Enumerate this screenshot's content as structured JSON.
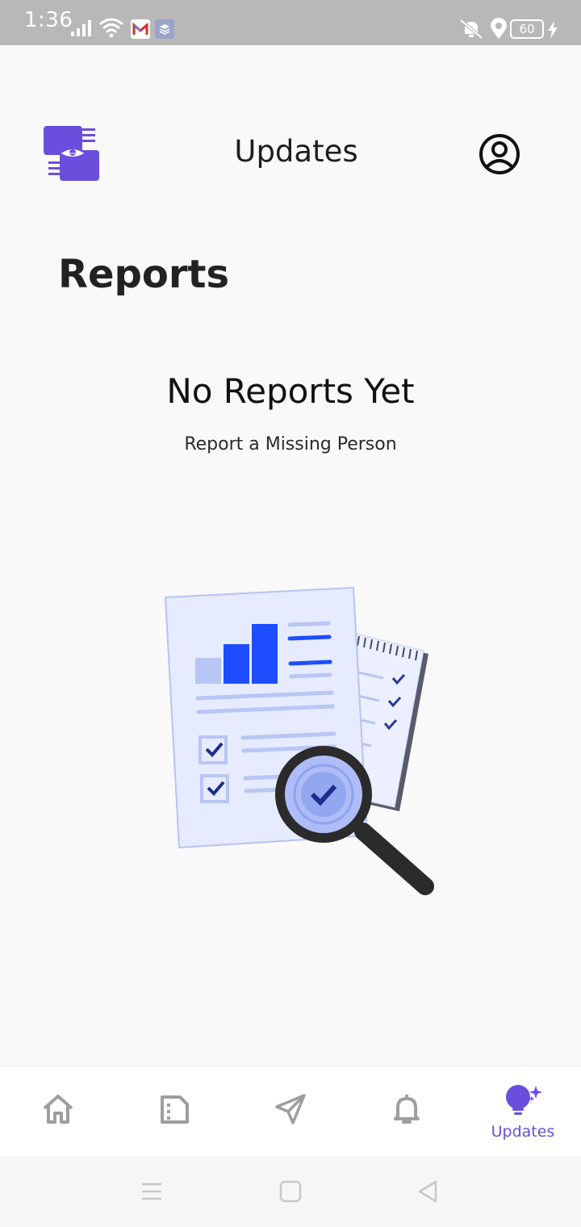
{
  "status_bar": {
    "time": "1:36",
    "battery": "60",
    "icons": [
      "signal-icon",
      "wifi-icon",
      "gmail-icon",
      "layers-app-icon",
      "vibrate-off-icon",
      "location-icon",
      "battery-icon",
      "charging-icon"
    ]
  },
  "header": {
    "title": "Updates",
    "logo_icon": "hands-eye-logo-icon",
    "profile_icon": "account-circle-icon"
  },
  "main": {
    "section_title": "Reports",
    "empty_state": {
      "title": "No Reports Yet",
      "subtitle": "Report a Missing Person",
      "illustration": "report-analysis-illustration"
    }
  },
  "bottom_nav": {
    "items": [
      {
        "icon": "home-icon",
        "label": "",
        "active": false
      },
      {
        "icon": "document-icon",
        "label": "",
        "active": false
      },
      {
        "icon": "send-icon",
        "label": "",
        "active": false
      },
      {
        "icon": "bell-icon",
        "label": "",
        "active": false
      },
      {
        "icon": "lightbulb-sparkle-icon",
        "label": "Updates",
        "active": true
      }
    ]
  },
  "system_nav": [
    "recents-icon",
    "home-square-icon",
    "back-icon"
  ],
  "colors": {
    "accent": "#6a4fdc",
    "status_bar": "#b8b8b8",
    "illustration_blue": "#1e4dff",
    "inactive_icon": "#9e9e9e"
  }
}
